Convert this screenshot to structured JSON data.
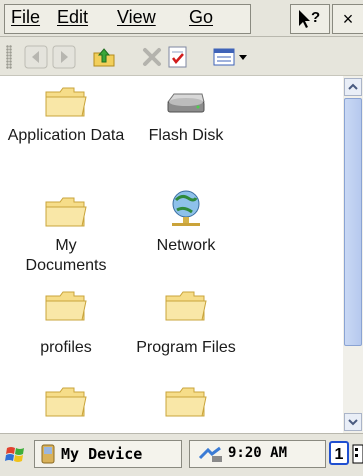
{
  "menu": {
    "file": "File",
    "edit": "Edit",
    "view": "View",
    "go": "Go",
    "help_icon": "?",
    "close": "×"
  },
  "toolbar": {
    "buttons": [
      "back-icon",
      "forward-icon",
      "up-folder-icon",
      "delete-icon",
      "properties-icon",
      "view-mode-icon"
    ]
  },
  "items": [
    {
      "label": "Application Data",
      "icon": "folder-icon"
    },
    {
      "label": "Flash Disk",
      "icon": "drive-icon"
    },
    {
      "label": "My Documents",
      "icon": "folder-icon"
    },
    {
      "label": "Network",
      "icon": "network-icon"
    },
    {
      "label": "profiles",
      "icon": "folder-icon"
    },
    {
      "label": "Program Files",
      "icon": "folder-icon"
    },
    {
      "label": "",
      "icon": "folder-icon"
    },
    {
      "label": "",
      "icon": "folder-icon"
    }
  ],
  "taskbar": {
    "task_label": "My Device",
    "time": "9:20 AM",
    "input_panel": "1"
  },
  "colors": {
    "chrome": "#e6e5dc",
    "folder": "#f5d77a",
    "scroll_thumb": "#b6c9ee"
  }
}
